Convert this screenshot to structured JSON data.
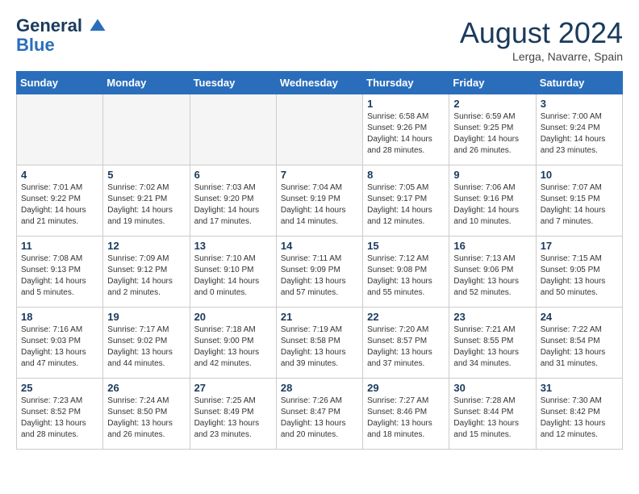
{
  "header": {
    "logo_line1": "General",
    "logo_line2": "Blue",
    "month": "August 2024",
    "location": "Lerga, Navarre, Spain"
  },
  "days_of_week": [
    "Sunday",
    "Monday",
    "Tuesday",
    "Wednesday",
    "Thursday",
    "Friday",
    "Saturday"
  ],
  "weeks": [
    [
      {
        "day": "",
        "info": ""
      },
      {
        "day": "",
        "info": ""
      },
      {
        "day": "",
        "info": ""
      },
      {
        "day": "",
        "info": ""
      },
      {
        "day": "1",
        "info": "Sunrise: 6:58 AM\nSunset: 9:26 PM\nDaylight: 14 hours\nand 28 minutes."
      },
      {
        "day": "2",
        "info": "Sunrise: 6:59 AM\nSunset: 9:25 PM\nDaylight: 14 hours\nand 26 minutes."
      },
      {
        "day": "3",
        "info": "Sunrise: 7:00 AM\nSunset: 9:24 PM\nDaylight: 14 hours\nand 23 minutes."
      }
    ],
    [
      {
        "day": "4",
        "info": "Sunrise: 7:01 AM\nSunset: 9:22 PM\nDaylight: 14 hours\nand 21 minutes."
      },
      {
        "day": "5",
        "info": "Sunrise: 7:02 AM\nSunset: 9:21 PM\nDaylight: 14 hours\nand 19 minutes."
      },
      {
        "day": "6",
        "info": "Sunrise: 7:03 AM\nSunset: 9:20 PM\nDaylight: 14 hours\nand 17 minutes."
      },
      {
        "day": "7",
        "info": "Sunrise: 7:04 AM\nSunset: 9:19 PM\nDaylight: 14 hours\nand 14 minutes."
      },
      {
        "day": "8",
        "info": "Sunrise: 7:05 AM\nSunset: 9:17 PM\nDaylight: 14 hours\nand 12 minutes."
      },
      {
        "day": "9",
        "info": "Sunrise: 7:06 AM\nSunset: 9:16 PM\nDaylight: 14 hours\nand 10 minutes."
      },
      {
        "day": "10",
        "info": "Sunrise: 7:07 AM\nSunset: 9:15 PM\nDaylight: 14 hours\nand 7 minutes."
      }
    ],
    [
      {
        "day": "11",
        "info": "Sunrise: 7:08 AM\nSunset: 9:13 PM\nDaylight: 14 hours\nand 5 minutes."
      },
      {
        "day": "12",
        "info": "Sunrise: 7:09 AM\nSunset: 9:12 PM\nDaylight: 14 hours\nand 2 minutes."
      },
      {
        "day": "13",
        "info": "Sunrise: 7:10 AM\nSunset: 9:10 PM\nDaylight: 14 hours\nand 0 minutes."
      },
      {
        "day": "14",
        "info": "Sunrise: 7:11 AM\nSunset: 9:09 PM\nDaylight: 13 hours\nand 57 minutes."
      },
      {
        "day": "15",
        "info": "Sunrise: 7:12 AM\nSunset: 9:08 PM\nDaylight: 13 hours\nand 55 minutes."
      },
      {
        "day": "16",
        "info": "Sunrise: 7:13 AM\nSunset: 9:06 PM\nDaylight: 13 hours\nand 52 minutes."
      },
      {
        "day": "17",
        "info": "Sunrise: 7:15 AM\nSunset: 9:05 PM\nDaylight: 13 hours\nand 50 minutes."
      }
    ],
    [
      {
        "day": "18",
        "info": "Sunrise: 7:16 AM\nSunset: 9:03 PM\nDaylight: 13 hours\nand 47 minutes."
      },
      {
        "day": "19",
        "info": "Sunrise: 7:17 AM\nSunset: 9:02 PM\nDaylight: 13 hours\nand 44 minutes."
      },
      {
        "day": "20",
        "info": "Sunrise: 7:18 AM\nSunset: 9:00 PM\nDaylight: 13 hours\nand 42 minutes."
      },
      {
        "day": "21",
        "info": "Sunrise: 7:19 AM\nSunset: 8:58 PM\nDaylight: 13 hours\nand 39 minutes."
      },
      {
        "day": "22",
        "info": "Sunrise: 7:20 AM\nSunset: 8:57 PM\nDaylight: 13 hours\nand 37 minutes."
      },
      {
        "day": "23",
        "info": "Sunrise: 7:21 AM\nSunset: 8:55 PM\nDaylight: 13 hours\nand 34 minutes."
      },
      {
        "day": "24",
        "info": "Sunrise: 7:22 AM\nSunset: 8:54 PM\nDaylight: 13 hours\nand 31 minutes."
      }
    ],
    [
      {
        "day": "25",
        "info": "Sunrise: 7:23 AM\nSunset: 8:52 PM\nDaylight: 13 hours\nand 28 minutes."
      },
      {
        "day": "26",
        "info": "Sunrise: 7:24 AM\nSunset: 8:50 PM\nDaylight: 13 hours\nand 26 minutes."
      },
      {
        "day": "27",
        "info": "Sunrise: 7:25 AM\nSunset: 8:49 PM\nDaylight: 13 hours\nand 23 minutes."
      },
      {
        "day": "28",
        "info": "Sunrise: 7:26 AM\nSunset: 8:47 PM\nDaylight: 13 hours\nand 20 minutes."
      },
      {
        "day": "29",
        "info": "Sunrise: 7:27 AM\nSunset: 8:46 PM\nDaylight: 13 hours\nand 18 minutes."
      },
      {
        "day": "30",
        "info": "Sunrise: 7:28 AM\nSunset: 8:44 PM\nDaylight: 13 hours\nand 15 minutes."
      },
      {
        "day": "31",
        "info": "Sunrise: 7:30 AM\nSunset: 8:42 PM\nDaylight: 13 hours\nand 12 minutes."
      }
    ]
  ]
}
